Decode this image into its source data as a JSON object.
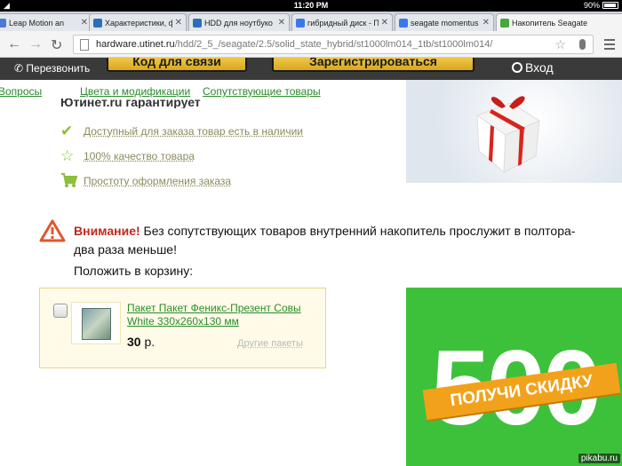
{
  "status_bar": {
    "time": "11:20 PM",
    "battery": "90%",
    "battery_level": 0.9
  },
  "tabs": [
    {
      "title": "Leap Motion an",
      "favicon_color": "#4a7bd1",
      "active": false
    },
    {
      "title": "Характеристики, ф",
      "favicon_color": "#2c6fb7",
      "active": false
    },
    {
      "title": "HDD для ноутбуко",
      "favicon_color": "#2c6fb7",
      "active": false
    },
    {
      "title": "гибридный диск - П",
      "favicon_color": "#3b78e7",
      "active": false
    },
    {
      "title": "seagate momentus x",
      "favicon_color": "#3b78e7",
      "active": false
    },
    {
      "title": "Накопитель Seagate",
      "favicon_color": "#47a83a",
      "active": true
    }
  ],
  "address_bar": {
    "host": "hardware.utinet.ru",
    "path": "/hdd/2_5_/seagate/2.5/solid_state_hybrid/st1000lm014_1tb/st1000lm014/"
  },
  "header": {
    "call_label": "Перезвонить",
    "code_button": "Код для связи",
    "register_button": "Зарегистрироваться",
    "login_label": "Вход"
  },
  "subnav": [
    "Вопросы",
    "Цвета и модификации",
    "Сопутствующие товары"
  ],
  "guarantee_title": "Ютинет.ru гарантирует",
  "features": [
    {
      "icon": "check-icon",
      "text": "Доступный для заказа товар есть в наличии"
    },
    {
      "icon": "star-icon",
      "text": "100% качество товара"
    },
    {
      "icon": "cart-icon",
      "text": "Простоту оформления заказа"
    }
  ],
  "warning": {
    "title": "Внимание!",
    "text": "Без сопутствующих товаров внутренний накопитель прослужит в полтора-два раза меньше!",
    "put_to_cart": "Положить в корзину:"
  },
  "product": {
    "name": "Пакет Пакет Феникс-Презент Совы White 330x260x130 мм",
    "price": "30",
    "currency": "р.",
    "other_link": "Другие пакеты"
  },
  "promo": {
    "number": "500",
    "ribbon": "ПОЛУЧИ СКИДКУ"
  },
  "watermark": "pikabu.ru",
  "colors": {
    "link_green": "#2a8c2a",
    "warning_red": "#c0281b",
    "promo_green": "#3ec13a"
  }
}
